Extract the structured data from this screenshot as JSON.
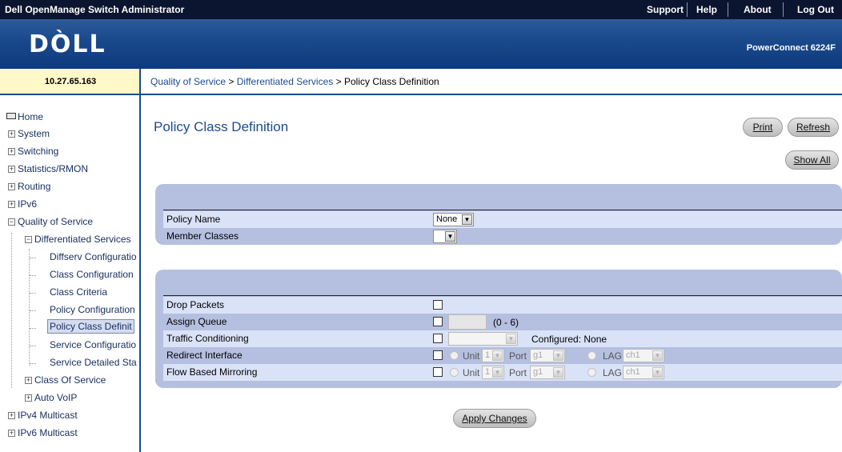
{
  "header": {
    "app_title": "Dell OpenManage Switch Administrator",
    "links": [
      "Support",
      "Help",
      "About",
      "Log Out"
    ],
    "logo_text": "DÒLL",
    "model": "PowerConnect 6224F"
  },
  "ip_address": "10.27.65.163",
  "breadcrumb": {
    "part1": "Quality of Service",
    "part2": "Differentiated Services",
    "current": "Policy Class Definition",
    "sep": ">"
  },
  "nav": {
    "home": "Home",
    "system": "System",
    "switching": "Switching",
    "statistics": "Statistics/RMON",
    "routing": "Routing",
    "ipv6": "IPv6",
    "qos": "Quality of Service",
    "diffserv": "Differentiated Services",
    "diffserv_children": [
      "Diffserv Configuratio",
      "Class Configuration",
      "Class Criteria",
      "Policy Configuration",
      "Policy Class Definit",
      "Service Configuratio",
      "Service Detailed Sta"
    ],
    "class_of_service": "Class Of Service",
    "auto_voip": "Auto VoIP",
    "ipv4_multicast": "IPv4 Multicast",
    "ipv6_multicast": "IPv6 Multicast"
  },
  "page": {
    "title": "Policy Class Definition",
    "print": "Print",
    "refresh": "Refresh",
    "show_all": "Show All",
    "apply": "Apply Changes"
  },
  "policy": {
    "policy_name_label": "Policy Name",
    "policy_name_value": "None",
    "member_classes_label": "Member Classes",
    "member_classes_value": ""
  },
  "actions": {
    "drop_packets": "Drop Packets",
    "assign_queue": "Assign Queue",
    "assign_queue_range": "(0 - 6)",
    "traffic_conditioning": "Traffic Conditioning",
    "configured": "Configured: None",
    "redirect_interface": "Redirect Interface",
    "flow_mirroring": "Flow Based Mirroring",
    "unit_label": "Unit",
    "unit_value": "1",
    "port_label": "Port",
    "port_value": "g1",
    "lag_label": "LAG",
    "lag_value": "ch1"
  }
}
